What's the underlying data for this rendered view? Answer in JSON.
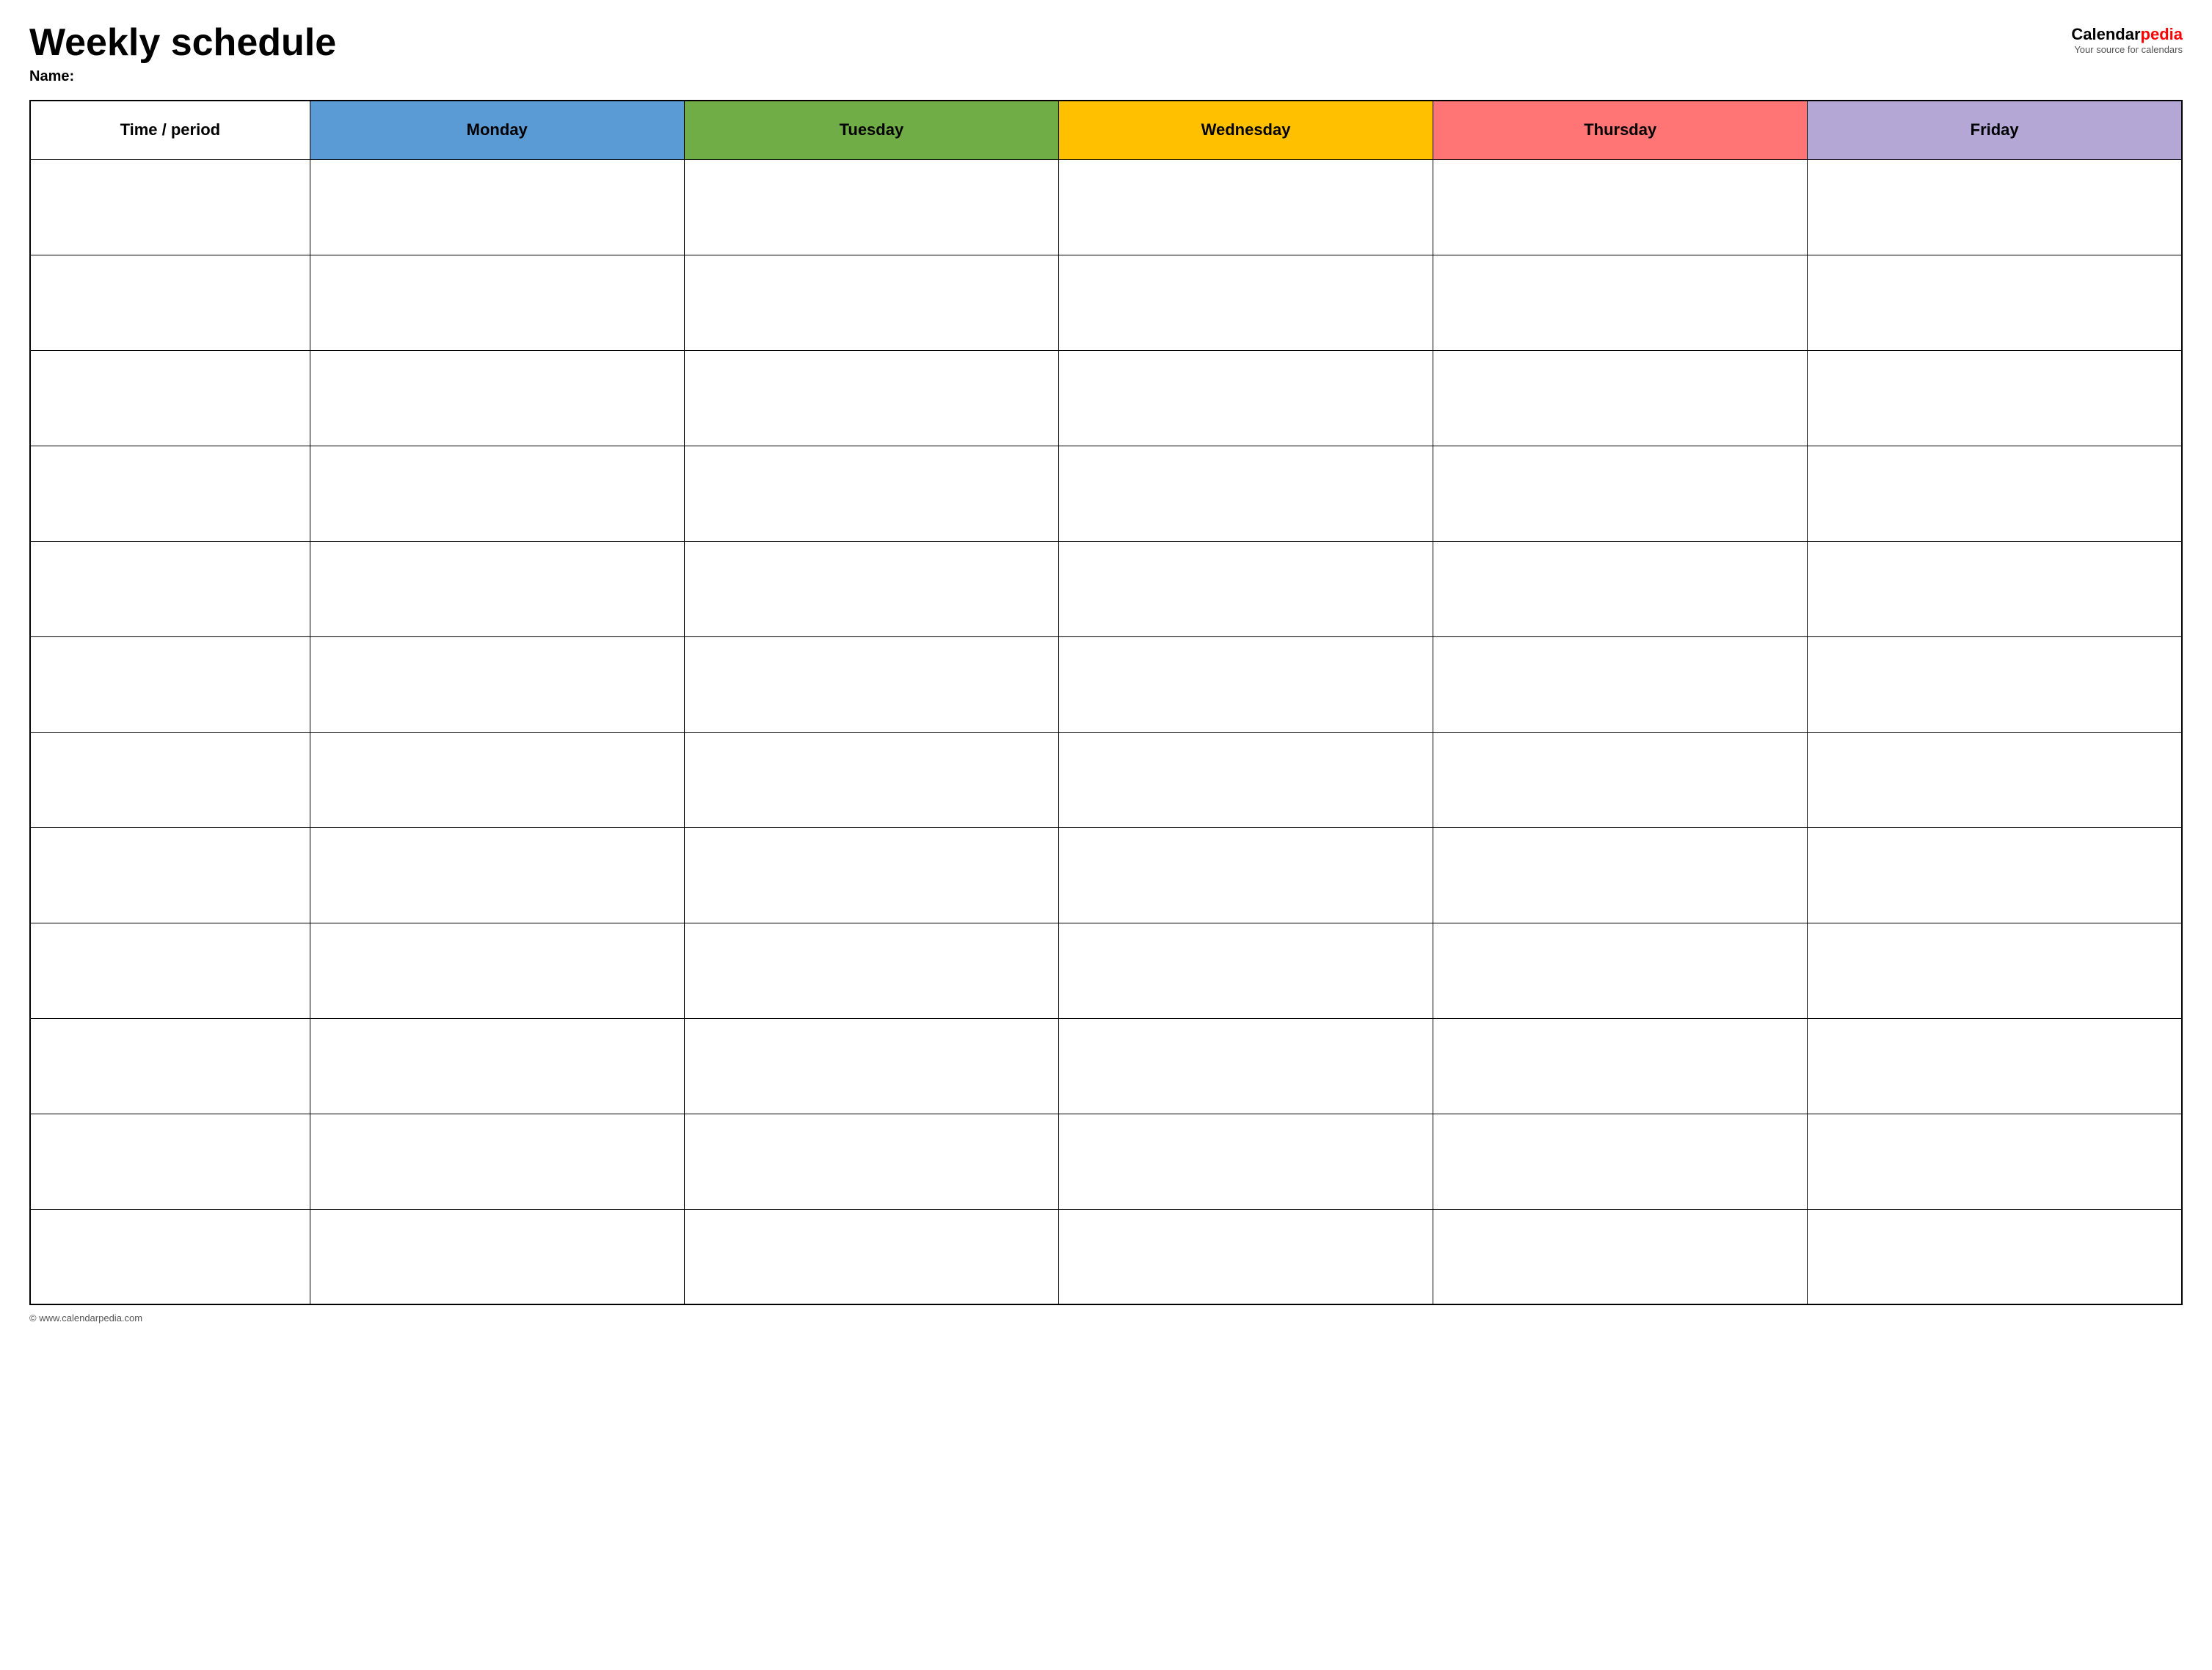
{
  "header": {
    "title": "Weekly schedule",
    "name_label": "Name:",
    "logo_calendar": "Calendar",
    "logo_pedia": "pedia",
    "logo_tagline": "Your source for calendars"
  },
  "table": {
    "columns": [
      {
        "key": "time",
        "label": "Time / period",
        "color_class": "time-period-header"
      },
      {
        "key": "monday",
        "label": "Monday",
        "color_class": "monday-header"
      },
      {
        "key": "tuesday",
        "label": "Tuesday",
        "color_class": "tuesday-header"
      },
      {
        "key": "wednesday",
        "label": "Wednesday",
        "color_class": "wednesday-header"
      },
      {
        "key": "thursday",
        "label": "Thursday",
        "color_class": "thursday-header"
      },
      {
        "key": "friday",
        "label": "Friday",
        "color_class": "friday-header"
      }
    ],
    "row_count": 12
  },
  "footer": {
    "url": "© www.calendarpedia.com"
  }
}
